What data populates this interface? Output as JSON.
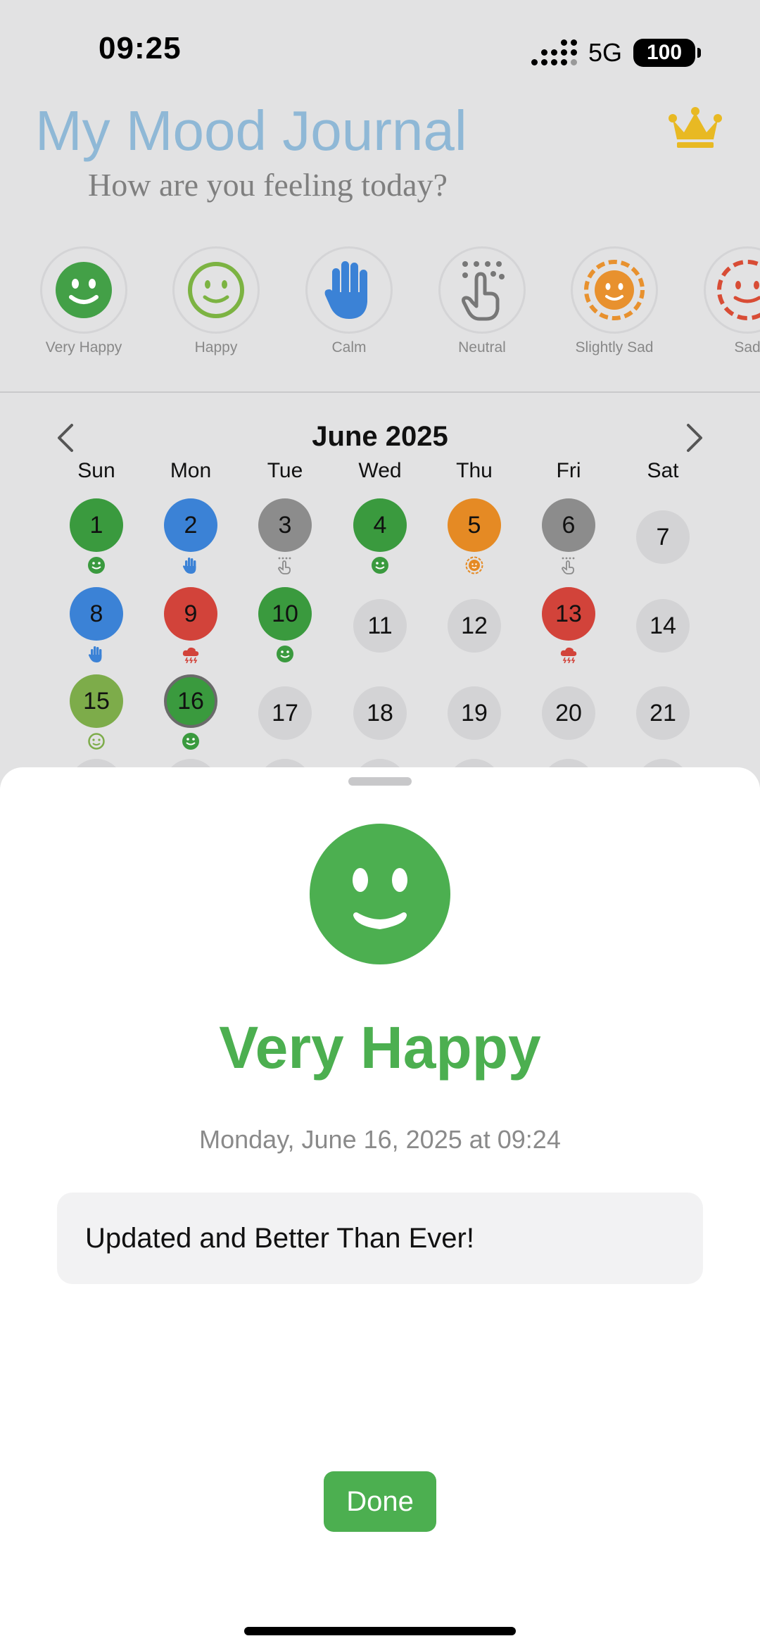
{
  "status": {
    "time": "09:25",
    "network": "5G",
    "battery": "100"
  },
  "header": {
    "title": "My Mood Journal",
    "subtitle": "How are you feeling today?",
    "premium_icon": "crown-icon"
  },
  "moods": [
    {
      "label": "Very Happy",
      "icon": "very-happy-face-icon",
      "color": "#43a047"
    },
    {
      "label": "Happy",
      "icon": "happy-face-icon",
      "color": "#7cb342"
    },
    {
      "label": "Calm",
      "icon": "raised-hand-icon",
      "color": "#3b82d6"
    },
    {
      "label": "Neutral",
      "icon": "touch-hand-icon",
      "color": "#888888"
    },
    {
      "label": "Slightly Sad",
      "icon": "sun-face-icon",
      "color": "#e8912e"
    },
    {
      "label": "Sad",
      "icon": "sad-face-icon",
      "color": "#d84c35"
    }
  ],
  "calendar": {
    "month": "June 2025",
    "weekdays": [
      "Sun",
      "Mon",
      "Tue",
      "Wed",
      "Thu",
      "Fri",
      "Sat"
    ],
    "days": [
      {
        "day": "1",
        "mood": "very-happy"
      },
      {
        "day": "2",
        "mood": "calm"
      },
      {
        "day": "3",
        "mood": "neutral"
      },
      {
        "day": "4",
        "mood": "very-happy"
      },
      {
        "day": "5",
        "mood": "slightly-sad"
      },
      {
        "day": "6",
        "mood": "neutral"
      },
      {
        "day": "7",
        "mood": ""
      },
      {
        "day": "8",
        "mood": "calm"
      },
      {
        "day": "9",
        "mood": "stormy"
      },
      {
        "day": "10",
        "mood": "very-happy"
      },
      {
        "day": "11",
        "mood": ""
      },
      {
        "day": "12",
        "mood": ""
      },
      {
        "day": "13",
        "mood": "stormy"
      },
      {
        "day": "14",
        "mood": ""
      },
      {
        "day": "15",
        "mood": "happy"
      },
      {
        "day": "16",
        "mood": "very-happy",
        "today": true
      },
      {
        "day": "17",
        "mood": ""
      },
      {
        "day": "18",
        "mood": ""
      },
      {
        "day": "19",
        "mood": ""
      },
      {
        "day": "20",
        "mood": ""
      },
      {
        "day": "21",
        "mood": ""
      }
    ],
    "mood_colors": {
      "very-happy": "#3a9a3e",
      "happy": "#7dac4a",
      "calm": "#3b82d6",
      "neutral": "#8c8c8c",
      "slightly-sad": "#e58a24",
      "stormy": "#d2433a"
    }
  },
  "sheet": {
    "mood_name": "Very Happy",
    "mood_color": "#4caf50",
    "date_line": "Monday, June 16, 2025 at 09:24",
    "note": "Updated and Better Than Ever!",
    "done_label": "Done"
  }
}
